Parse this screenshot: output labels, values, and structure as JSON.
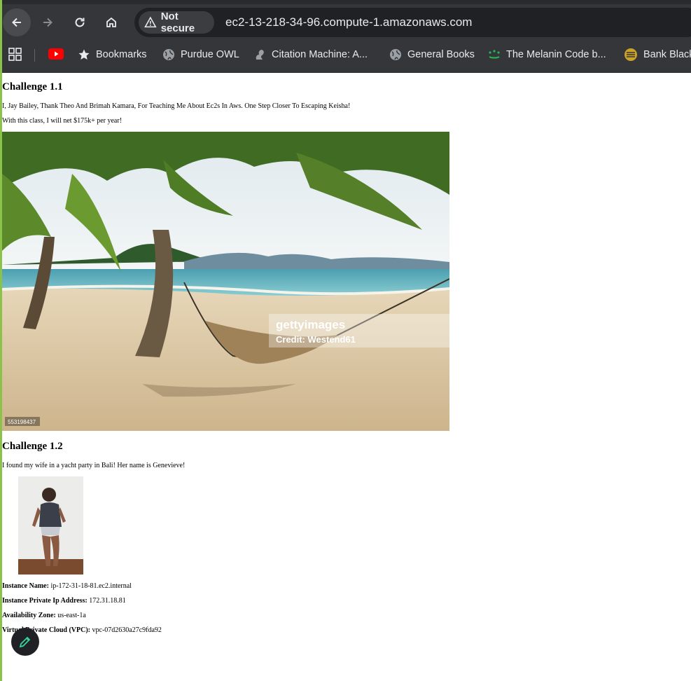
{
  "browser": {
    "security_label": "Not secure",
    "url": "ec2-13-218-34-96.compute-1.amazonaws.com",
    "bookmarks": [
      {
        "label": "Bookmarks"
      },
      {
        "label": "Purdue OWL"
      },
      {
        "label": "Citation Machine: A..."
      },
      {
        "label": "General Books"
      },
      {
        "label": "The Melanin Code b..."
      },
      {
        "label": "Bank Black"
      }
    ]
  },
  "page": {
    "section1": {
      "heading": "Challenge 1.1",
      "line1": "I, Jay Bailey, Thank Theo And Brimah Kamara, For Teaching Me About Ec2s In Aws. One Step Closer To Escaping Keisha!",
      "line2": "With this class, I will net $175k+ per year!",
      "image": {
        "watermark_brand": "gettyimages",
        "watermark_credit": "Credit: Westend61",
        "image_id": "553198437"
      }
    },
    "section2": {
      "heading": "Challenge 1.2",
      "line1": "I found my wife in a yacht party in Bali! Her name is Genevieve!"
    },
    "instance": [
      {
        "label": "Instance Name:",
        "value": "ip-172-31-18-81.ec2.internal"
      },
      {
        "label": "Instance Private Ip Address:",
        "value": "172.31.18.81"
      },
      {
        "label": "Availability Zone:",
        "value": "us-east-1a"
      },
      {
        "label": "Virtual Private Cloud (VPC):",
        "value": "vpc-07d2630a27c9fda92"
      }
    ]
  }
}
